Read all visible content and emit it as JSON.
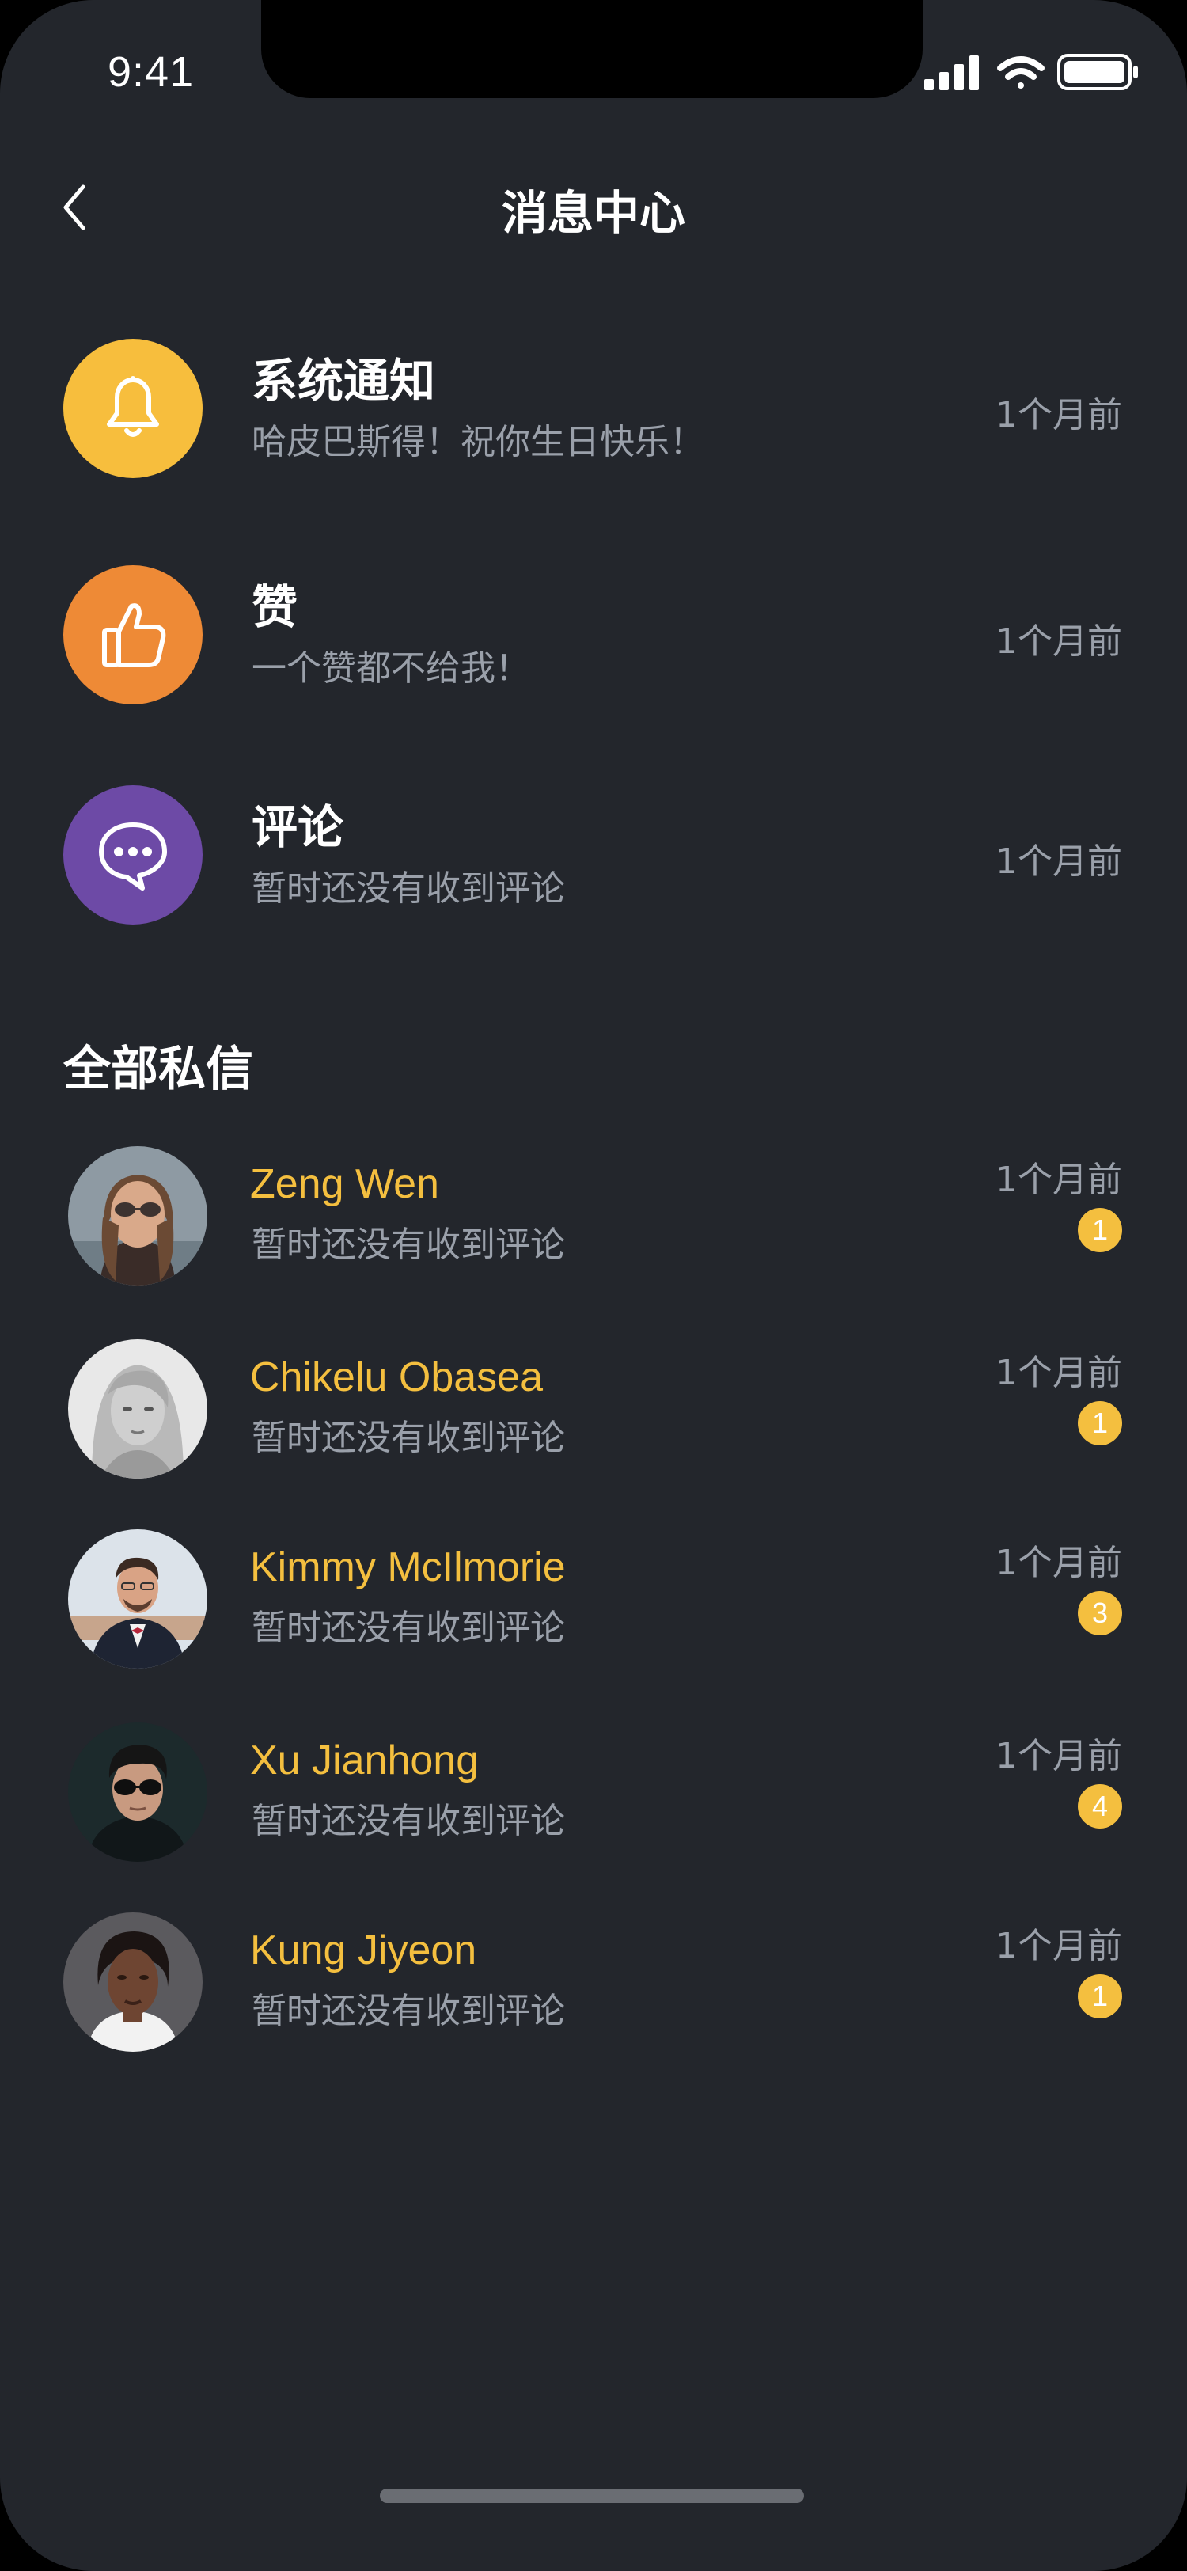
{
  "status_bar": {
    "time": "9:41"
  },
  "nav": {
    "title": "消息中心"
  },
  "notifications": [
    {
      "title": "系统通知",
      "subtitle": "哈皮巴斯得！祝你生日快乐！",
      "time": "1个月前",
      "icon": "bell-icon",
      "color": "#f7be3d"
    },
    {
      "title": "赞",
      "subtitle": "一个赞都不给我！",
      "time": "1个月前",
      "icon": "thumbs-up-icon",
      "color": "#ee8a36"
    },
    {
      "title": "评论",
      "subtitle": "暂时还没有收到评论",
      "time": "1个月前",
      "icon": "chat-bubble-icon",
      "color": "#6d4aa6"
    }
  ],
  "messages_section": {
    "title": "全部私信"
  },
  "messages": [
    {
      "name": "Zeng Wen",
      "preview": "暂时还没有收到评论",
      "time": "1个月前",
      "unread": "1"
    },
    {
      "name": "Chikelu Obasea",
      "preview": "暂时还没有收到评论",
      "time": "1个月前",
      "unread": "1"
    },
    {
      "name": "Kimmy McIlmorie",
      "preview": "暂时还没有收到评论",
      "time": "1个月前",
      "unread": "3"
    },
    {
      "name": "Xu Jianhong",
      "preview": "暂时还没有收到评论",
      "time": "1个月前",
      "unread": "4"
    },
    {
      "name": "Kung Jiyeon",
      "preview": "暂时还没有收到评论",
      "time": "1个月前",
      "unread": "1"
    }
  ],
  "colors": {
    "background": "#23262c",
    "accent": "#f4bf3f",
    "muted_text": "#9aa0aa"
  }
}
